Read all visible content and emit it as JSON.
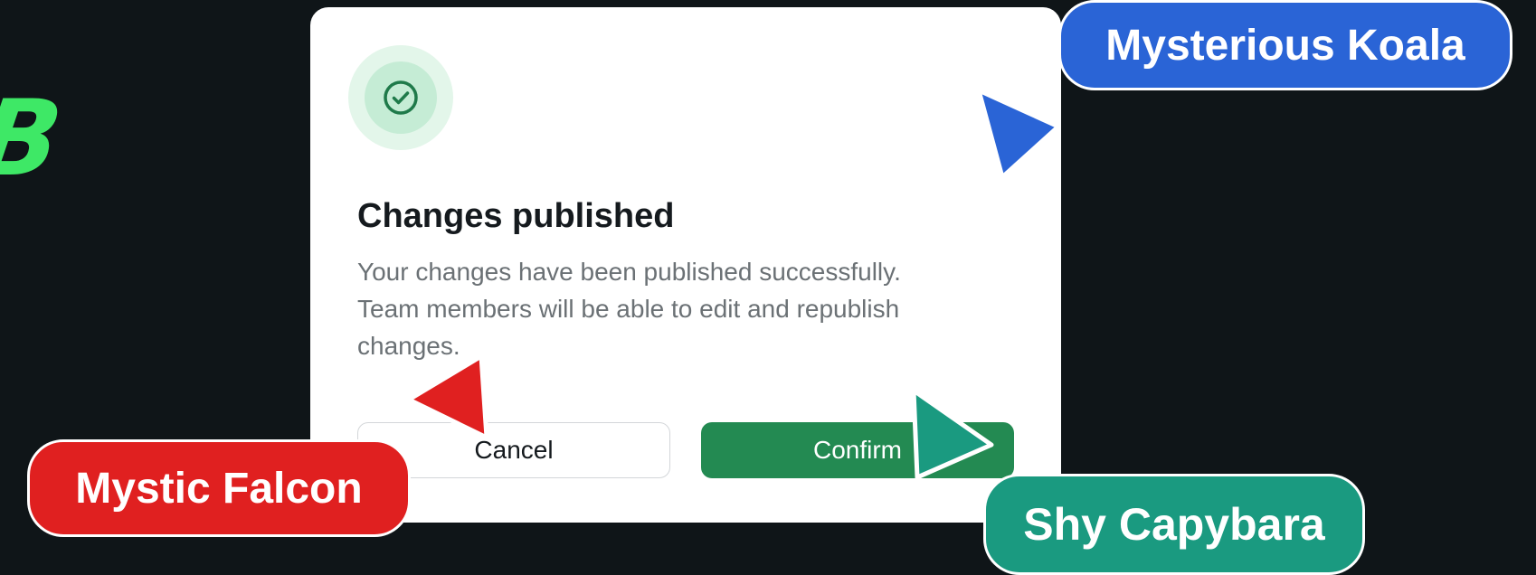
{
  "logo": {
    "fragment": "B"
  },
  "dialog": {
    "title": "Changes published",
    "message_lines": [
      "Your changes have been published successfully.",
      "Team members will be able to edit and republish",
      "changes."
    ],
    "cancel_label": "Cancel",
    "confirm_label": "Confirm",
    "icon": "check-circle-icon"
  },
  "collaborators": [
    {
      "name": "Mysterious Koala",
      "color": "#2a64d6"
    },
    {
      "name": "Mystic Falcon",
      "color": "#e02020"
    },
    {
      "name": "Shy Capybara",
      "color": "#1a9a80"
    }
  ],
  "colors": {
    "background": "#0f1518",
    "accent": "#238a52",
    "logo": "#3ee866"
  }
}
